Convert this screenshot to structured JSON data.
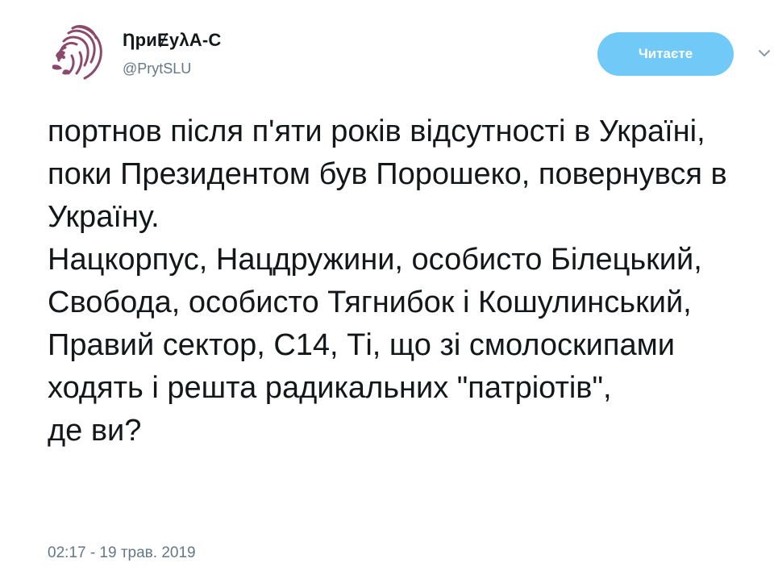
{
  "user": {
    "display_name": "ȠриɆуλА-С",
    "handle": "@PrytSLU",
    "avatar_icon": "lion-logo-icon",
    "avatar_color": "#8b4a6b"
  },
  "follow_button": {
    "label": "Читаєте",
    "color": "#71c9f8"
  },
  "menu": {
    "icon": "chevron-down-icon"
  },
  "tweet": {
    "text": "портнов після п'яти років відсутності в Україні,\nпоки Президентом був Порошеко, повернувся в Україну.\nНацкорпус, Нацдружини, особисто Білецький, Свобода, особисто Тягнибок і Кошулинський, Правий сектор, С14, Ті, що зі смолоскипами ходять і решта радикальних \"патріотів\",\nде ви?",
    "timestamp": "02:17 - 19 трав. 2019"
  }
}
